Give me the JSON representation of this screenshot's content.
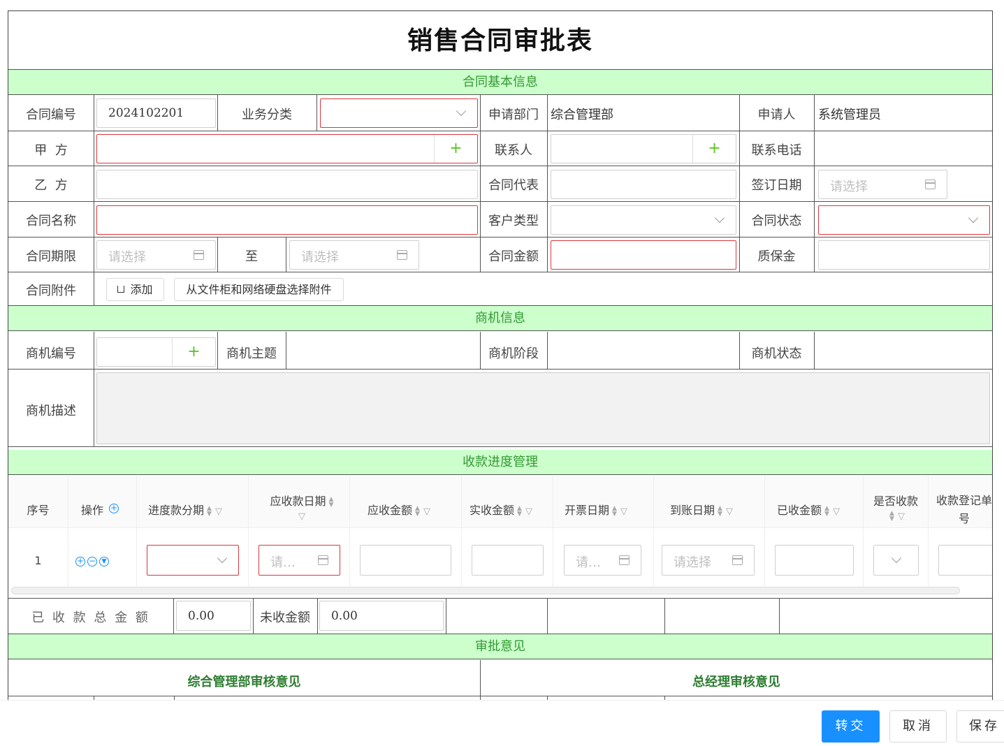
{
  "form": {
    "title": "销售合同审批表",
    "sections": {
      "basic": "合同基本信息",
      "opportunity": "商机信息",
      "receipt": "收款进度管理",
      "approval": "审批意见"
    },
    "basic": {
      "contract_no_label": "合同编号",
      "contract_no_value": "2024102201",
      "biz_category_label": "业务分类",
      "apply_dept_label": "申请部门",
      "apply_dept_value": "综合管理部",
      "applicant_label": "申请人",
      "applicant_value": "系统管理员",
      "party_a_label": "甲  方",
      "contact_label": "联系人",
      "contact_phone_label": "联系电话",
      "party_b_label": "乙  方",
      "contract_rep_label": "合同代表",
      "sign_date_label": "签订日期",
      "sign_date_placeholder": "请选择",
      "contract_name_label": "合同名称",
      "customer_type_label": "客户类型",
      "contract_status_label": "合同状态",
      "term_label": "合同期限",
      "term_start_placeholder": "请选择",
      "to_label": "至",
      "term_end_placeholder": "请选择",
      "amount_label": "合同金额",
      "deposit_label": "质保金",
      "attachment_label": "合同附件",
      "add_button": "添加",
      "pick_button": "从文件柜和网络硬盘选择附件"
    },
    "opportunity": {
      "no_label": "商机编号",
      "subject_label": "商机主题",
      "stage_label": "商机阶段",
      "status_label": "商机状态",
      "desc_label": "商机描述"
    },
    "receipt": {
      "columns": [
        "序号",
        "操作",
        "进度款分期",
        "应收款日期",
        "应收金额",
        "实收金额",
        "开票日期",
        "到账日期",
        "已收金额",
        "是否收款",
        "收款登记单号"
      ],
      "rows": [
        {
          "index": "1",
          "receivable_date_placeholder": "请…",
          "invoice_date_placeholder": "请…",
          "arrival_date_placeholder": "请选择"
        }
      ],
      "total_received_label": "已 收 款 总 金 额",
      "total_received_value": "0.00",
      "unreceived_label": "未收金额",
      "unreceived_value": "0.00"
    },
    "approval": {
      "dept_review": "综合管理部审核意见",
      "gm_review": "总经理审核意见"
    }
  },
  "footer": {
    "transfer": "转交",
    "cancel": "取消",
    "save": "保存"
  },
  "colors": {
    "section_bg": "#ccffcc",
    "section_text": "#339933",
    "primary": "#1890ff",
    "required_border": "#d9363e"
  }
}
